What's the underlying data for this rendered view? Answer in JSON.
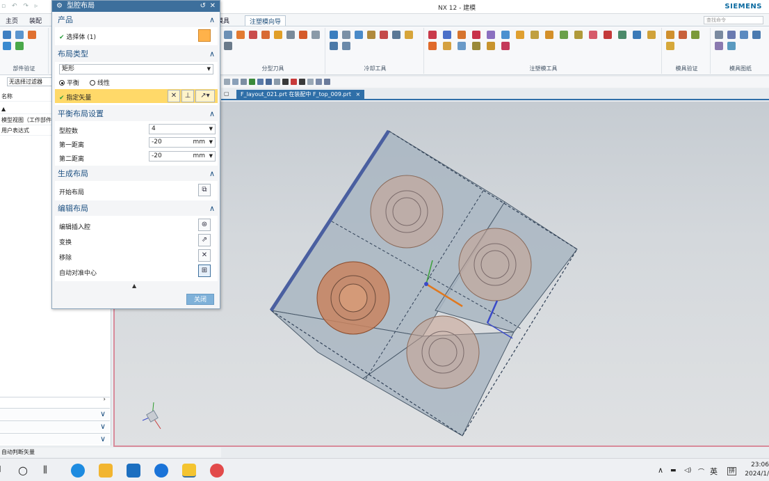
{
  "window": {
    "title": "NX 12 - 建模",
    "brand": "SIEMENS",
    "quick_access": "▫ ↶ ↷ ▹"
  },
  "ribbon": {
    "tabs": [
      {
        "label": "主页"
      },
      {
        "label": "装配"
      },
      {
        "label": "模具"
      },
      {
        "label": "注塑模向导"
      }
    ],
    "search_placeholder": "查找命令",
    "groups": [
      {
        "label": "部件验证"
      },
      {
        "label": "分型刀具"
      },
      {
        "label": "冷却工具"
      },
      {
        "label": "注塑模工具"
      },
      {
        "label": "模具验证"
      },
      {
        "label": "模具图纸"
      }
    ]
  },
  "navigator": {
    "filter": "无选择过滤器",
    "title": "名称",
    "rows": [
      {
        "label": "▲"
      },
      {
        "label": "模型视图（工作部件"
      },
      {
        "label": "用户表达式"
      }
    ],
    "scroll_glyph": "›",
    "accordion_glyph": "∨",
    "status_text": "自动判断矢量"
  },
  "graphics": {
    "file_tab": "F_layout_021.prt 在装配中 F_top_009.prt",
    "file_tab_close": "×",
    "tab_ctrl": "▢"
  },
  "dialog": {
    "title": "型腔布局",
    "title_icons": {
      "reset": "↺",
      "close": "✕"
    },
    "sections": {
      "product": {
        "header": "产品",
        "select_label": "选择体 (1)"
      },
      "layout_type": {
        "header": "布局类型",
        "type_value": "矩形",
        "radio_plane": "平衡",
        "radio_linear": "线性",
        "vector_label": "指定矢量"
      },
      "balanced": {
        "header": "平衡布局设置",
        "cavity_count_label": "型腔数",
        "cavity_count_value": "4",
        "first_dist_label": "第一距离",
        "first_dist_value": "-20",
        "second_dist_label": "第二距离",
        "second_dist_value": "-20",
        "unit": "mm"
      },
      "generate": {
        "header": "生成布局",
        "start_label": "开始布局"
      },
      "edit": {
        "header": "编辑布局",
        "items": [
          {
            "label": "编辑插入腔"
          },
          {
            "label": "变换"
          },
          {
            "label": "移除"
          },
          {
            "label": "自动对准中心"
          }
        ]
      }
    },
    "collapse_glyph": "▲",
    "caret_glyph": "∧",
    "close_label": "关闭"
  },
  "taskbar": {
    "ime_label": "英",
    "ime_mode": "拼",
    "time": "23:06",
    "date": "2024/1/"
  },
  "colors": {
    "dialog_title": "#3d6f9c",
    "accent": "#2f6fa8",
    "highlight_row": "#ffd969",
    "cavity_orange": "#c9845f"
  }
}
